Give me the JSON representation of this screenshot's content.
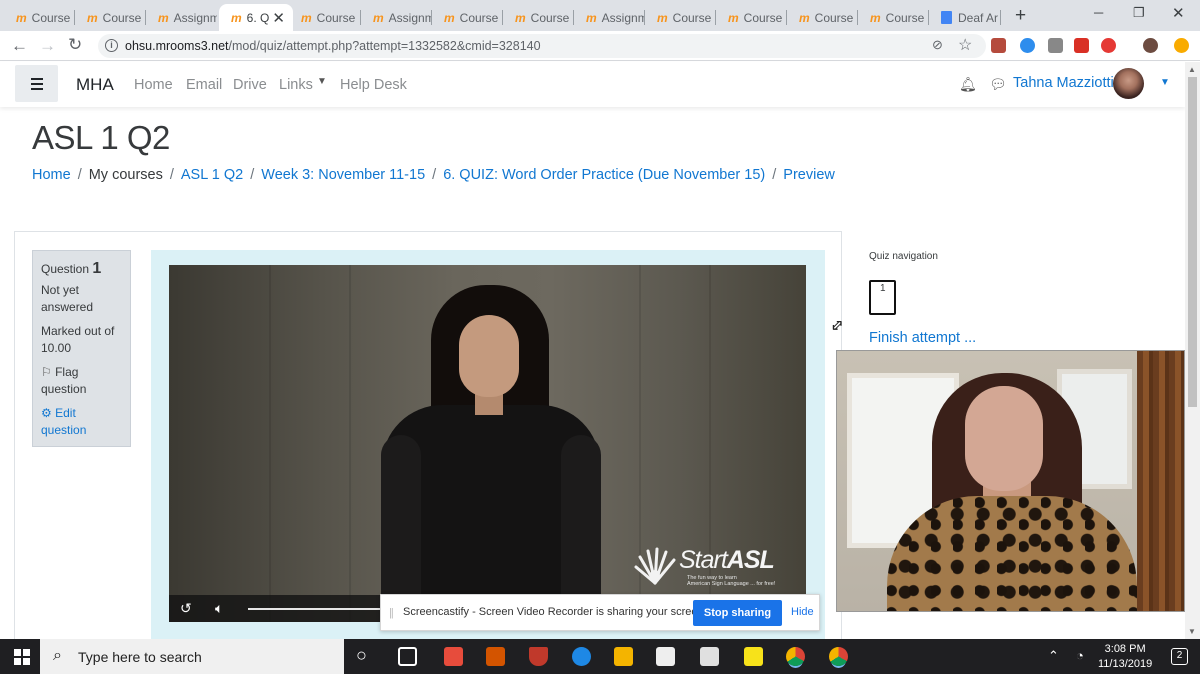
{
  "browser": {
    "tabs": [
      {
        "label": "Course"
      },
      {
        "label": "Course"
      },
      {
        "label": "Assignm"
      },
      {
        "label": "6. Q",
        "active": true
      },
      {
        "label": "Course"
      },
      {
        "label": "Assignm"
      },
      {
        "label": "Course"
      },
      {
        "label": "Course"
      },
      {
        "label": "Assignm"
      },
      {
        "label": "Course"
      },
      {
        "label": "Course"
      },
      {
        "label": "Course"
      },
      {
        "label": "Course"
      },
      {
        "label": "Deaf Ar"
      }
    ],
    "tab_favicon": "m",
    "url_host": "ohsu.mrooms3.net",
    "url_path": "/mod/quiz/attempt.php?attempt=1332582&cmid=328140"
  },
  "navbar": {
    "brand": "MHA",
    "links": [
      "Home",
      "Email",
      "Drive",
      "Links",
      "Help Desk"
    ],
    "user_name": "Tahna Mazziotti"
  },
  "page": {
    "title": "ASL 1 Q2",
    "breadcrumb": [
      "Home",
      "My courses",
      "ASL 1 Q2",
      "Week 3: November 11-15",
      "6. QUIZ: Word Order Practice (Due November 15)",
      "Preview"
    ],
    "breadcrumb_sep": "/"
  },
  "question_info": {
    "label": "Question",
    "number": "1",
    "status": "Not yet answered",
    "marked": "Marked out of 10.00",
    "flag": "Flag question",
    "edit": "Edit question"
  },
  "video": {
    "logo_text_light": "Start",
    "logo_text_bold": "ASL",
    "logo_sub_line1": "The fun way to learn",
    "logo_sub_line2": "American Sign Language ... for free!"
  },
  "quiz_nav": {
    "title": "Quiz navigation",
    "question_number": "1",
    "finish_label": "Finish attempt ..."
  },
  "screencastify": {
    "message": "Screencastify - Screen Video Recorder is sharing your screen.",
    "stop_label": "Stop sharing",
    "hide_label": "Hide"
  },
  "taskbar": {
    "search_placeholder": "Type here to search",
    "time": "3:08 PM",
    "date": "11/13/2019",
    "notifications": "2"
  },
  "colors": {
    "link": "#1177d1",
    "accent_blue": "#1a73e8",
    "question_bg": "#dbf1f6",
    "moodle_orange": "#f7941d"
  }
}
